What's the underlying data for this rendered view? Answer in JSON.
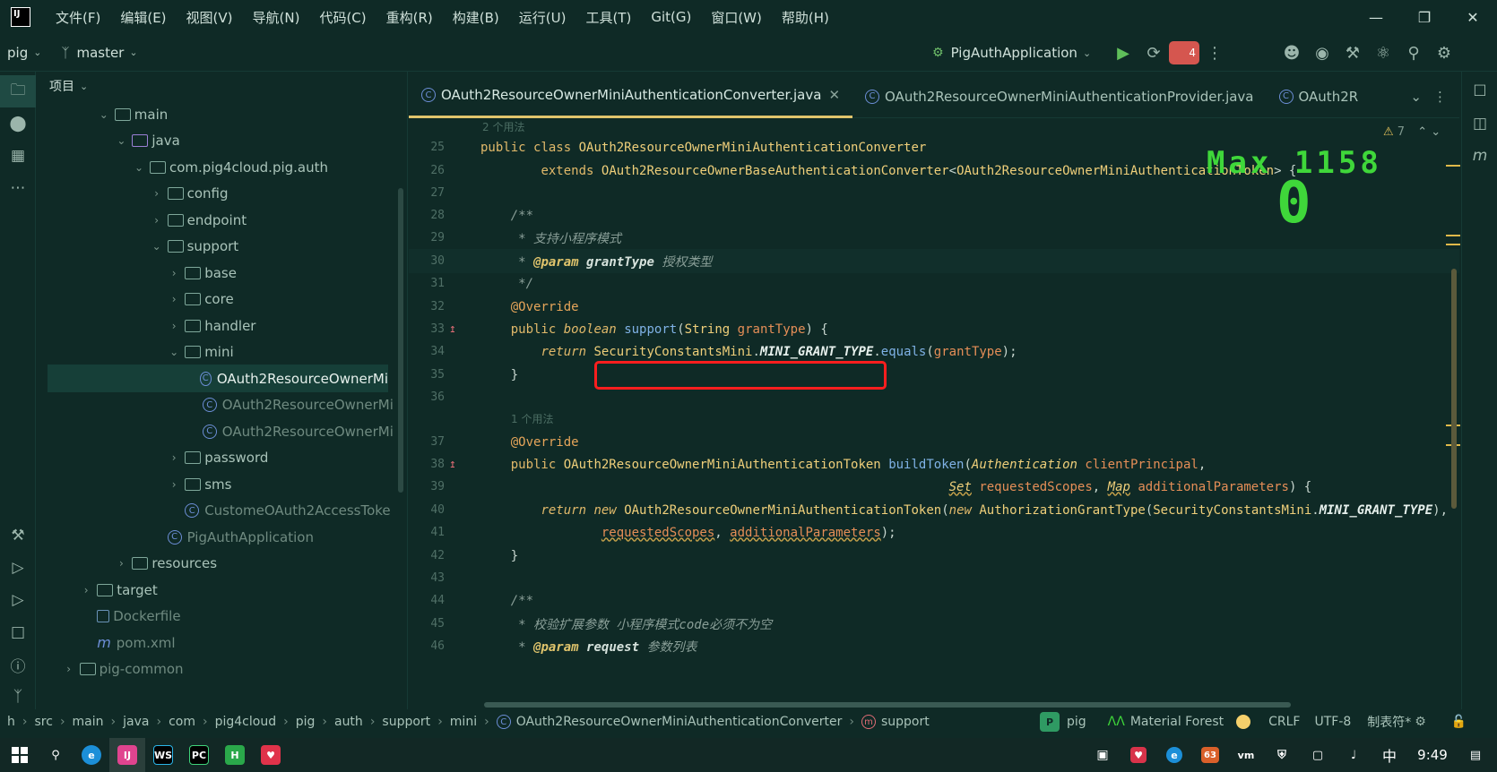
{
  "menu": [
    "文件(F)",
    "编辑(E)",
    "视图(V)",
    "导航(N)",
    "代码(C)",
    "重构(R)",
    "构建(B)",
    "运行(U)",
    "工具(T)",
    "Git(G)",
    "窗口(W)",
    "帮助(H)"
  ],
  "app_logo": "IJ",
  "toolbar": {
    "project": "pig",
    "branch": "master",
    "run_config": "PigAuthApplication",
    "badge_count": "4"
  },
  "project_panel": {
    "header": "项目",
    "rows": [
      {
        "label": "main",
        "depth": 3,
        "arrow": "v",
        "icon": "folder",
        "style": "normal"
      },
      {
        "label": "java",
        "depth": 4,
        "arrow": "v",
        "icon": "source-folder",
        "style": "normal"
      },
      {
        "label": "com.pig4cloud.pig.auth",
        "depth": 5,
        "arrow": "v",
        "icon": "package",
        "style": "normal"
      },
      {
        "label": "config",
        "depth": 6,
        "arrow": ">",
        "icon": "package",
        "style": "normal"
      },
      {
        "label": "endpoint",
        "depth": 6,
        "arrow": ">",
        "icon": "package",
        "style": "normal"
      },
      {
        "label": "support",
        "depth": 6,
        "arrow": "v",
        "icon": "package",
        "style": "normal"
      },
      {
        "label": "base",
        "depth": 7,
        "arrow": ">",
        "icon": "package",
        "style": "normal"
      },
      {
        "label": "core",
        "depth": 7,
        "arrow": ">",
        "icon": "package",
        "style": "normal"
      },
      {
        "label": "handler",
        "depth": 7,
        "arrow": ">",
        "icon": "package",
        "style": "normal"
      },
      {
        "label": "mini",
        "depth": 7,
        "arrow": "v",
        "icon": "package",
        "style": "normal"
      },
      {
        "label": "OAuth2ResourceOwnerMi",
        "depth": 8,
        "arrow": "",
        "icon": "class",
        "style": "selected"
      },
      {
        "label": "OAuth2ResourceOwnerMi",
        "depth": 8,
        "arrow": "",
        "icon": "class",
        "style": "dim"
      },
      {
        "label": "OAuth2ResourceOwnerMi",
        "depth": 8,
        "arrow": "",
        "icon": "class",
        "style": "dim"
      },
      {
        "label": "password",
        "depth": 7,
        "arrow": ">",
        "icon": "package",
        "style": "normal"
      },
      {
        "label": "sms",
        "depth": 7,
        "arrow": ">",
        "icon": "package",
        "style": "normal"
      },
      {
        "label": "CustomeOAuth2AccessToke",
        "depth": 7,
        "arrow": "",
        "icon": "class",
        "style": "dim"
      },
      {
        "label": "PigAuthApplication",
        "depth": 6,
        "arrow": "",
        "icon": "class",
        "style": "dim"
      },
      {
        "label": "resources",
        "depth": 4,
        "arrow": ">",
        "icon": "folder",
        "style": "normal"
      },
      {
        "label": "target",
        "depth": 2,
        "arrow": ">",
        "icon": "folder",
        "style": "normal"
      },
      {
        "label": "Dockerfile",
        "depth": 2,
        "arrow": "",
        "icon": "file",
        "style": "dim"
      },
      {
        "label": "pom.xml",
        "depth": 2,
        "arrow": "",
        "icon": "maven",
        "style": "dim"
      },
      {
        "label": "pig-common",
        "depth": 1,
        "arrow": ">",
        "icon": "folder",
        "style": "dim"
      }
    ]
  },
  "tabs": [
    {
      "label": "OAuth2ResourceOwnerMiniAuthenticationConverter.java",
      "active": true
    },
    {
      "label": "OAuth2ResourceOwnerMiniAuthenticationProvider.java",
      "active": false
    },
    {
      "label": "OAuth2R",
      "active": false
    }
  ],
  "editor": {
    "warning_count": "7",
    "hints": {
      "usages_top": "2 个用法",
      "usages_mid": "1 个用法"
    },
    "lines": {
      "25": {
        "n": "25"
      },
      "26": {
        "n": "26"
      },
      "27": {
        "n": "27"
      },
      "28": {
        "n": "28"
      },
      "29": {
        "n": "29"
      },
      "30": {
        "n": "30"
      },
      "31": {
        "n": "31"
      },
      "32": {
        "n": "32"
      },
      "33": {
        "n": "33"
      },
      "34": {
        "n": "34"
      },
      "35": {
        "n": "35"
      },
      "36": {
        "n": "36"
      },
      "37": {
        "n": "37"
      },
      "38": {
        "n": "38"
      },
      "39": {
        "n": "39"
      },
      "40": {
        "n": "40"
      },
      "41": {
        "n": "41"
      },
      "42": {
        "n": "42"
      },
      "43": {
        "n": "43"
      },
      "44": {
        "n": "44"
      },
      "45": {
        "n": "45"
      },
      "46": {
        "n": "46"
      }
    },
    "tokens": {
      "public": "public",
      "class": "class",
      "class_name": "OAuth2ResourceOwnerMiniAuthenticationConverter",
      "extends": "extends",
      "base_class": "OAuth2ResourceOwnerBaseAuthenticationConverter",
      "lt": "<",
      "token_type": "OAuth2ResourceOwnerMiniAuthenticationToken",
      "gt": "> {",
      "doc_open": "/**",
      "doc_desc": " * 支持小程序模式",
      "doc_star": " * ",
      "param_tag": "@param",
      "param_name": "grantType",
      "param_desc": "授权类型",
      "doc_close": " */",
      "override": "@Override",
      "boolean": "boolean",
      "support": "support",
      "string_type": "String",
      "grant_type": "grantType",
      "open_brace": ") {",
      "return": "return",
      "constants": "SecurityConstantsMini",
      "dot": ".",
      "mini_grant": "MINI_GRANT_TYPE",
      "equals": "equals",
      "paren_open": "(",
      "paren_close": ");",
      "close_brace": "}",
      "build_return_type": "OAuth2ResourceOwnerMiniAuthenticationToken",
      "build_token": "buildToken",
      "authentication": "Authentication",
      "client_principal": "clientPrincipal",
      "comma": ",",
      "set": "Set",
      "requested_scopes": "requestedScopes",
      "map": "Map",
      "additional_params": "additionalParameters",
      "new": "new",
      "auth_grant_type": "AuthorizationGrantType",
      "doc_check": " * 校验扩展参数 小程序模式code必须不为空",
      "request": "request",
      "param_list": "参数列表"
    }
  },
  "power_mode": {
    "max_label": "Max",
    "max_value": "1158",
    "combo": "0"
  },
  "statusbar": {
    "crumbs": [
      "h",
      "src",
      "main",
      "java",
      "com",
      "pig4cloud",
      "pig",
      "auth",
      "support",
      "mini",
      "OAuth2ResourceOwnerMiniAuthenticationConverter",
      "support"
    ],
    "project": "pig",
    "theme": "Material Forest",
    "line_sep": "CRLF",
    "encoding": "UTF-8",
    "indent": "制表符*"
  },
  "taskbar": {
    "ime": "中",
    "time": "9:49",
    "badge": "63"
  },
  "colors": {
    "bg": "#0f2a26",
    "accent": "#e0c46c",
    "combo_green": "#3fd73a",
    "highlight_red": "#ff1e1e"
  }
}
